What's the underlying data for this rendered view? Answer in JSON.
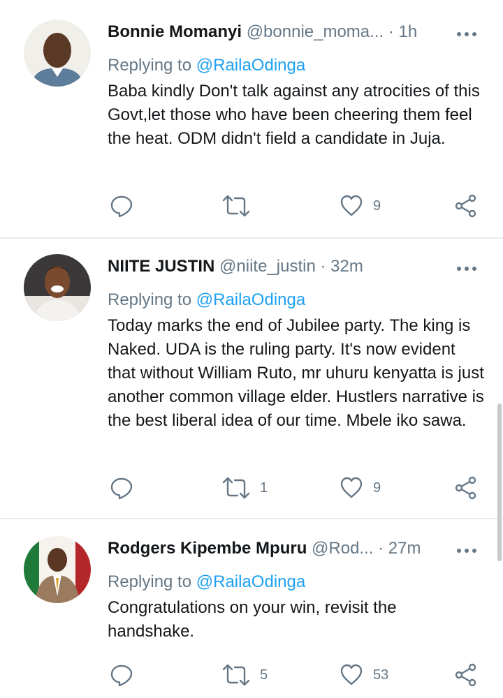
{
  "tweets": [
    {
      "name": "Bonnie Momanyi",
      "handle": "@bonnie_moma...",
      "time": "· 1h",
      "reply_prefix": "Replying to",
      "reply_to": "@RailaOdinga",
      "text": "Baba  kindly Don't talk against any atrocities of this Govt,let those who have been cheering them feel the heat. ODM didn't field a candidate in Juja.",
      "actions": {
        "reply_count": "",
        "retweet_count": "",
        "like_count": "9"
      }
    },
    {
      "name": "NIITE JUSTIN",
      "handle": "@niite_justin",
      "time": "· 32m",
      "reply_prefix": "Replying to",
      "reply_to": "@RailaOdinga",
      "text": "Today marks the end of Jubilee party. The king is Naked. UDA is the ruling party. It's now evident that without William Ruto, mr uhuru kenyatta is just another common village elder. Hustlers narrative is the best liberal idea of our time. Mbele iko sawa.",
      "actions": {
        "reply_count": "",
        "retweet_count": "1",
        "like_count": "9"
      }
    },
    {
      "name": "Rodgers Kipembe Mpuru",
      "handle": "@Rod...",
      "time": "· 27m",
      "reply_prefix": "Replying to",
      "reply_to": "@RailaOdinga",
      "text": "Congratulations on your win, revisit the handshake.",
      "actions": {
        "reply_count": "",
        "retweet_count": "5",
        "like_count": "53"
      }
    }
  ],
  "icons": [
    "reply-icon",
    "retweet-icon",
    "like-icon",
    "share-icon",
    "more-icon"
  ],
  "colors": {
    "text": "#14171a",
    "secondary": "#657786",
    "mention": "#1da1f2",
    "divider": "#e6ecf0"
  }
}
